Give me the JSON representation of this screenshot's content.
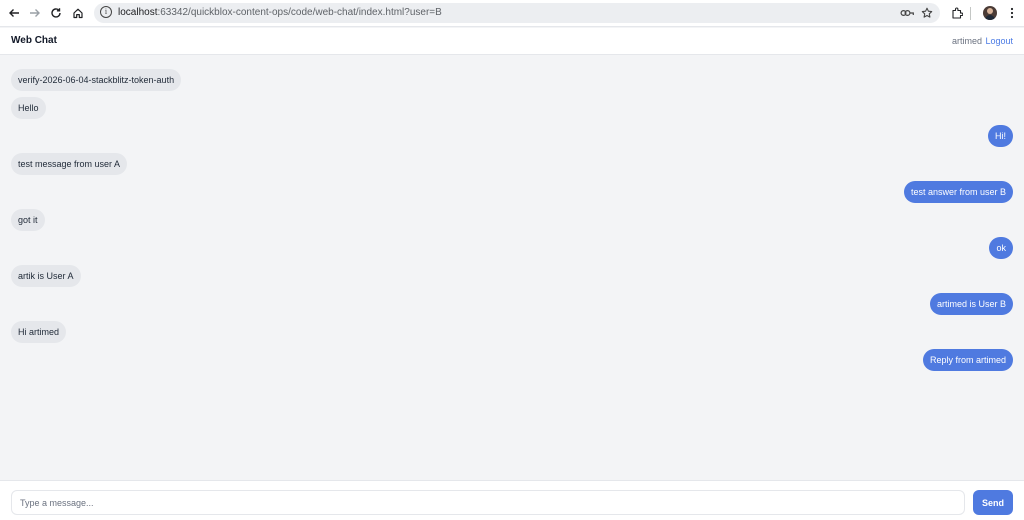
{
  "browser": {
    "url_host": "localhost",
    "url_rest": ":63342/quickblox-content-ops/code/web-chat/index.html?user=B",
    "icons": [
      "back-icon",
      "forward-icon",
      "reload-icon",
      "home-icon",
      "site-info-icon",
      "password-key-icon",
      "bookmark-star-icon",
      "extensions-icon",
      "profile-avatar",
      "menu-dots-icon"
    ]
  },
  "header": {
    "title": "Web Chat",
    "username": "artimed",
    "logout_label": "Logout"
  },
  "messages": [
    {
      "direction": "in",
      "text": "verify-2026-06-04-stackblitz-token-auth"
    },
    {
      "direction": "in",
      "text": "Hello"
    },
    {
      "direction": "out",
      "text": "Hi!"
    },
    {
      "direction": "in",
      "text": "test message from user A"
    },
    {
      "direction": "out",
      "text": "test answer from user B"
    },
    {
      "direction": "in",
      "text": "got it"
    },
    {
      "direction": "out",
      "text": "ok"
    },
    {
      "direction": "in",
      "text": "artik is User A"
    },
    {
      "direction": "out",
      "text": "artimed is User B"
    },
    {
      "direction": "in",
      "text": "Hi artimed"
    },
    {
      "direction": "out",
      "text": "Reply from artimed"
    }
  ],
  "composer": {
    "placeholder": "Type a message...",
    "value": "",
    "send_label": "Send"
  },
  "colors": {
    "accent": "#4f7ae0",
    "incoming_bubble": "#e5e7eb",
    "background": "#f3f4f6",
    "link": "#4b7be5"
  }
}
